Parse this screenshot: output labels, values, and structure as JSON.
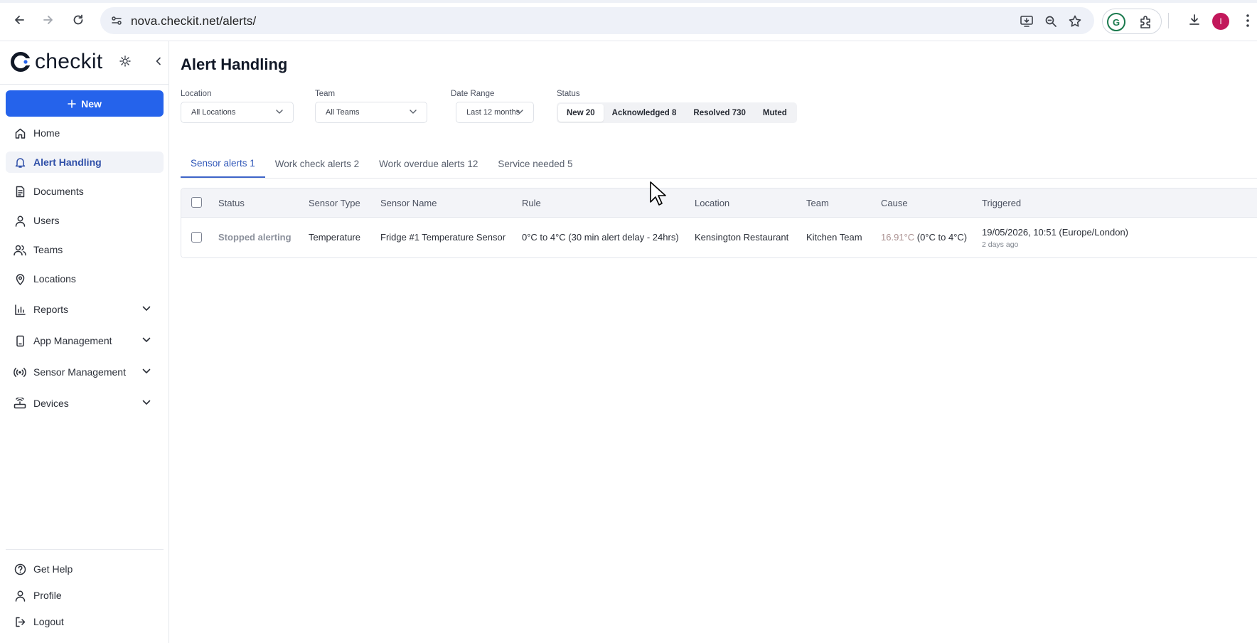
{
  "browser": {
    "url": "nova.checkit.net/alerts/",
    "profile_initial": "I",
    "icons": [
      "back-arrow-icon",
      "forward-arrow-icon",
      "reload-icon",
      "site-settings-icon",
      "install-app-icon",
      "zoom-icon",
      "star-icon",
      "grammarly-icon",
      "extensions-icon",
      "download-icon",
      "kebab-menu-icon"
    ]
  },
  "sidebar": {
    "brand": "checkit",
    "new_label": "New",
    "items": [
      {
        "label": "Home",
        "icon": "home-icon"
      },
      {
        "label": "Alert Handling",
        "icon": "bell-icon",
        "active": true
      },
      {
        "label": "Documents",
        "icon": "document-icon"
      },
      {
        "label": "Users",
        "icon": "user-icon"
      },
      {
        "label": "Teams",
        "icon": "users-icon"
      },
      {
        "label": "Locations",
        "icon": "location-pin-icon"
      },
      {
        "label": "Reports",
        "icon": "bar-chart-icon",
        "expandable": true
      },
      {
        "label": "App Management",
        "icon": "mobile-icon",
        "expandable": true
      },
      {
        "label": "Sensor Management",
        "icon": "broadcast-icon",
        "expandable": true
      },
      {
        "label": "Devices",
        "icon": "router-icon",
        "expandable": true
      }
    ],
    "bottom_items": [
      {
        "label": "Get Help",
        "icon": "help-circle-icon"
      },
      {
        "label": "Profile",
        "icon": "user-icon"
      },
      {
        "label": "Logout",
        "icon": "logout-icon"
      }
    ]
  },
  "page": {
    "title": "Alert Handling",
    "filters": {
      "location": {
        "label": "Location",
        "value": "All Locations"
      },
      "team": {
        "label": "Team",
        "value": "All Teams"
      },
      "date_range": {
        "label": "Date Range",
        "value": "Last 12 months"
      },
      "status": {
        "label": "Status",
        "options": [
          "New 20",
          "Acknowledged 8",
          "Resolved 730",
          "Muted"
        ],
        "selected": "New 20"
      }
    },
    "tabs": [
      "Sensor alerts 1",
      "Work check alerts 2",
      "Work overdue alerts 12",
      "Service needed 5"
    ],
    "active_tab": "Sensor alerts 1",
    "table": {
      "columns": [
        "Status",
        "Sensor Type",
        "Sensor Name",
        "Rule",
        "Location",
        "Team",
        "Cause",
        "Triggered"
      ],
      "rows": [
        {
          "status": "Stopped alerting",
          "sensor_type": "Temperature",
          "sensor_name": "Fridge #1 Temperature Sensor",
          "rule": "0°C to 4°C (30 min alert delay - 24hrs)",
          "location": "Kensington Restaurant",
          "team": "Kitchen Team",
          "cause_value": "16.91°C",
          "cause_range": "(0°C to 4°C)",
          "triggered": "19/05/2026, 10:51 (Europe/London)",
          "triggered_relative": "2 days ago"
        }
      ]
    }
  },
  "colors": {
    "accent": "#2563eb",
    "active_nav_text": "#2f4fa8",
    "profile_avatar": "#c2185b"
  }
}
